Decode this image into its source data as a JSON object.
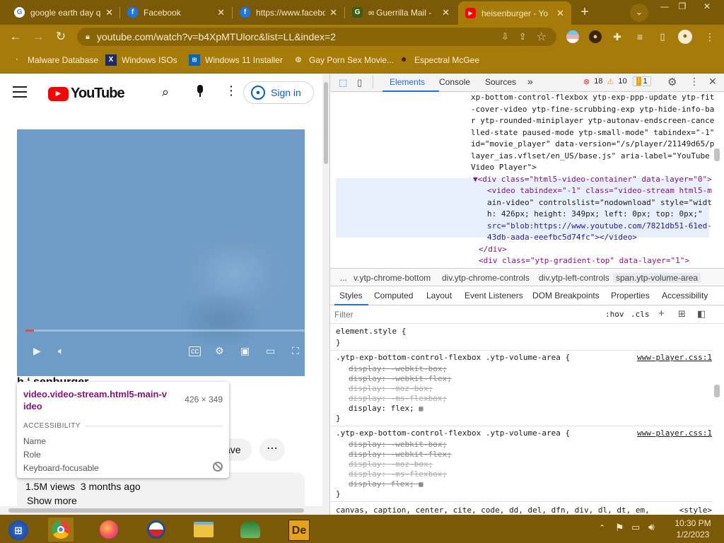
{
  "tabs": [
    {
      "title": "google earth day q",
      "icon": "G",
      "color": "#4285f4"
    },
    {
      "title": "Facebook",
      "icon": "f",
      "color": "#1877f2"
    },
    {
      "title": "https://www.facebo",
      "icon": "f",
      "color": "#1877f2"
    },
    {
      "title": "Guerrilla Mail -",
      "icon": "G",
      "color": "#3a5f1a"
    },
    {
      "title": "heisenburger - Yo",
      "icon": "▶",
      "color": "#ff0000"
    }
  ],
  "address": {
    "url": "youtube.com/watch?v=b4XpMTUlorc&list=LL&index=2"
  },
  "bookmarks": [
    "Malware Database",
    "Windows ISOs",
    "Windows 11 Installer",
    "Gay Porn Sex Movie...",
    "Espectral McGee"
  ],
  "youtube": {
    "logo_text": "YouTube",
    "sign_in": "Sign in",
    "video_title_partial": "h ‘ senburger",
    "save_label": "ave",
    "views": "1.5M views",
    "age": "3 months ago",
    "show_more": "Show more"
  },
  "tooltip": {
    "selector": "video.video-stream.html5-main-video",
    "selector_line1": "video.video-stream.html5-main-v",
    "selector_line2": "ideo",
    "size": "426 × 349",
    "section": "ACCESSIBILITY",
    "name_label": "Name",
    "role_label": "Role",
    "focusable_label": "Keyboard-focusable"
  },
  "devtools": {
    "tabs": [
      "Elements",
      "Console",
      "Sources"
    ],
    "active_tab": "Elements",
    "errors": "18",
    "warnings": "10",
    "issues": "1",
    "dom_lines": [
      "xp-bottom-control-flexbox ytp-exp-ppp-update ytp-fit",
      "-cover-video ytp-fine-scrubbing-exp ytp-hide-info-ba",
      "r ytp-rounded-miniplayer ytp-autonav-endscreen-cance",
      "lled-state paused-mode ytp-small-mode\" tabindex=\"-1\"",
      "id=\"movie_player\" data-version=\"/s/player/21149d65/p",
      "layer_ias.vflset/en_US/base.js\" aria-label=\"YouTube",
      "Video Player\">",
      "▼<div class=\"html5-video-container\" data-layer=\"0\">",
      "<video tabindex=\"-1\" class=\"video-stream html5-m",
      "ain-video\" controlslist=\"nodownload\" style=\"widt",
      "h: 426px; height: 349px; left: 0px; top: 0px;\"",
      "src=\"blob:https://www.youtube.com/7821db51-61ed-",
      "43db-aada-eeefbc5d74fc\"></video>",
      "</div>",
      "<div class=\"ytp-gradient-top\" data-layer=\"1\">"
    ],
    "breadcrumbs": [
      "...",
      "v.ytp-chrome-bottom",
      "div.ytp-chrome-controls",
      "div.ytp-left-controls",
      "span.ytp-volume-area"
    ],
    "style_tabs": [
      "Styles",
      "Computed",
      "Layout",
      "Event Listeners",
      "DOM Breakpoints",
      "Properties",
      "Accessibility"
    ],
    "filter_placeholder": "Filter",
    "hov": ":hov",
    "cls": ".cls",
    "style_source": "www-player.css:1",
    "style_lines": [
      "element.style {",
      "}",
      ".ytp-exp-bottom-control-flexbox .ytp-volume-area {",
      "display: -webkit-box;",
      "display: -webkit-flex;",
      "display: -moz-box;",
      "display: -ms-flexbox;",
      "display: flex;",
      "}",
      ".ytp-exp-bottom-control-flexbox .ytp-volume-area {",
      "display: -webkit-box;",
      "display: -webkit-flex;",
      "display: -moz-box;",
      "display: -ms-flexbox;",
      "display: flex;",
      "}",
      "canvas, caption, center, cite, code, dd, del, dfn, div, dl, dt, em,",
      "<style>"
    ]
  },
  "taskbar": {
    "time": "10:30 PM",
    "date": "1/2/2023"
  }
}
